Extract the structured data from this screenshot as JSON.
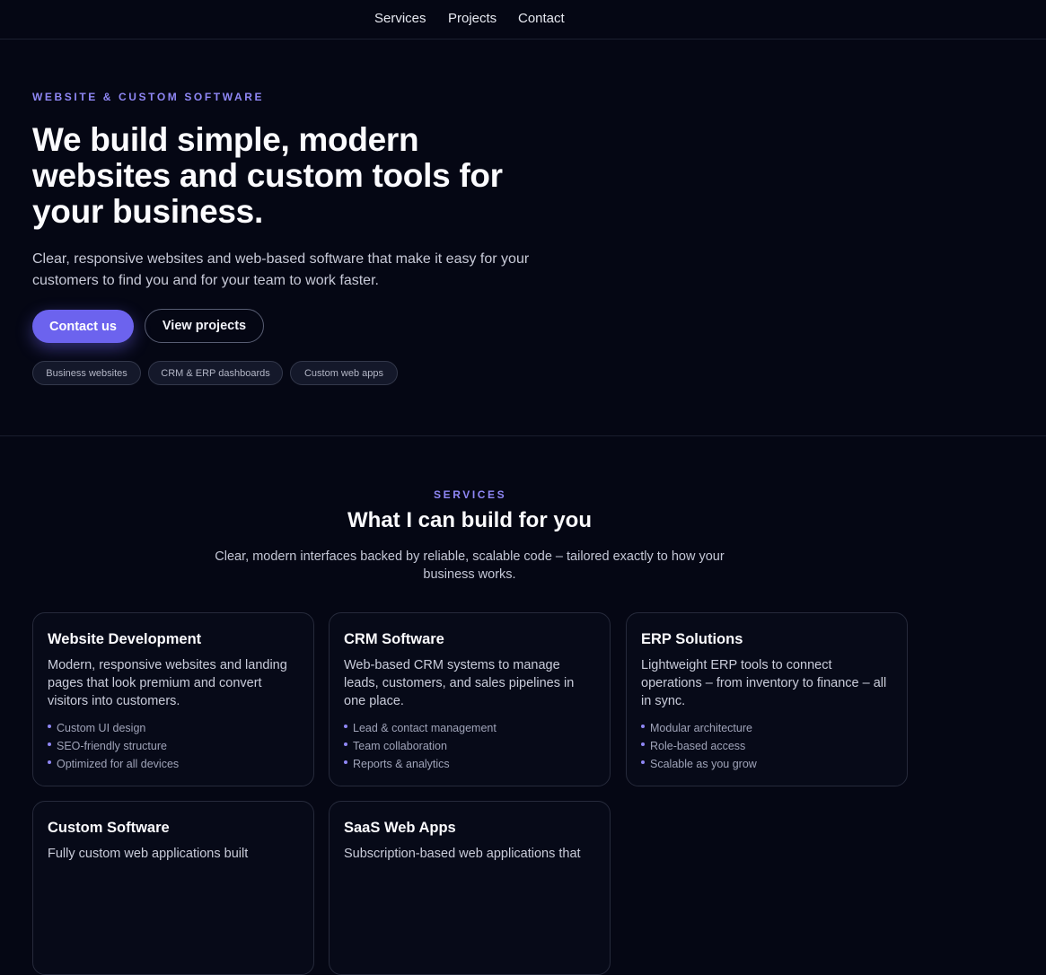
{
  "nav": {
    "links": [
      "Services",
      "Projects",
      "Contact"
    ]
  },
  "hero": {
    "eyebrow": "WEBSITE & CUSTOM SOFTWARE",
    "title": "We build simple, modern websites and custom tools for your business.",
    "subtitle": "Clear, responsive websites and web-based software that make it easy for your customers to find you and for your team to work faster.",
    "primary_button": "Contact us",
    "secondary_button": "View projects",
    "chips": [
      "Business websites",
      "CRM & ERP dashboards",
      "Custom web apps"
    ]
  },
  "services": {
    "eyebrow": "SERVICES",
    "title": "What I can build for you",
    "subtitle": "Clear, modern interfaces backed by reliable, scalable code – tailored exactly to how your business works.",
    "cards": [
      {
        "title": "Website Development",
        "description": "Modern, responsive websites and landing pages that look premium and convert visitors into customers.",
        "items": [
          "Custom UI design",
          "SEO-friendly structure",
          "Optimized for all devices"
        ]
      },
      {
        "title": "CRM Software",
        "description": "Web-based CRM systems to manage leads, customers, and sales pipelines in one place.",
        "items": [
          "Lead & contact management",
          "Team collaboration",
          "Reports & analytics"
        ]
      },
      {
        "title": "ERP Solutions",
        "description": "Lightweight ERP tools to connect operations – from inventory to finance – all in sync.",
        "items": [
          "Modular architecture",
          "Role-based access",
          "Scalable as you grow"
        ]
      },
      {
        "title": "Custom Software",
        "description": "Fully custom web applications built",
        "items": []
      },
      {
        "title": "SaaS Web Apps",
        "description": "Subscription-based web applications that",
        "items": []
      }
    ]
  },
  "colors": {
    "background": "#050714",
    "accent": "#6c63ee",
    "eyebrow": "#8f87f5"
  }
}
